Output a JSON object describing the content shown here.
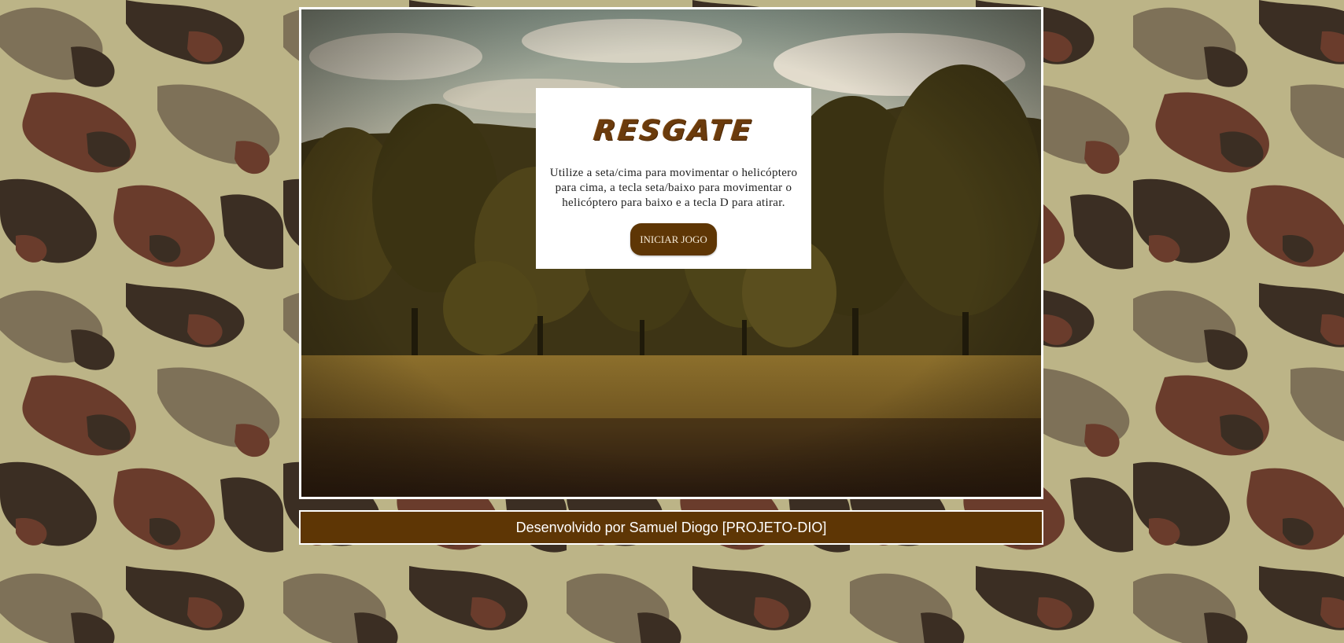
{
  "game": {
    "title": "RESGATE",
    "instructions": "Utilize a seta/cima para movimentar o helicóptero para cima, a tecla seta/baixo para movimentar o helicóptero para baixo e a tecla D para atirar.",
    "start_button_label": "INICIAR JOGO"
  },
  "footer": {
    "credit": "Desenvolvido por Samuel Diogo [PROJETO-DIO]"
  },
  "colors": {
    "brand_brown": "#5e3605",
    "title_brown": "#6b3b0c",
    "frame_border": "#ffffff",
    "camo_base": "#bcb487",
    "camo_dark": "#3b2e23",
    "camo_brown": "#6a3c2c",
    "camo_grey": "#7e7158"
  },
  "background": {
    "pattern": "camouflage",
    "scene": "forest-landscape"
  }
}
